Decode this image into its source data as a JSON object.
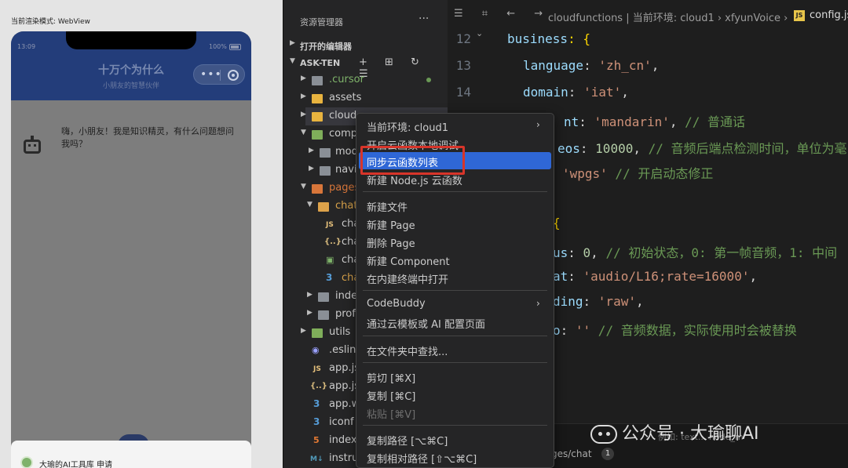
{
  "simulator": {
    "render_mode": "当前渲染模式: WebView",
    "status_time": "13:09",
    "status_battery": "100%",
    "app_title": "十万个为什么",
    "app_subtitle": "小朋友的智慧伙伴",
    "capsule_dots": "•••",
    "bot_message": "嗨，小朋友！我是知识精灵，有什么问题想问我吗？",
    "bottom_card_text": "大瑜的AI工具库 申请"
  },
  "explorer": {
    "title": "资源管理器",
    "more": "···",
    "open_editors": "打开的编辑器",
    "root": "ASK-TEN",
    "toolbar_icons": "+ ⊞ ↻ ☰",
    "items": [
      {
        "label": ".cursor"
      },
      {
        "label": "assets"
      },
      {
        "label": "cloud"
      },
      {
        "label": "comp"
      },
      {
        "label": "mod"
      },
      {
        "label": "navi"
      },
      {
        "label": "pages"
      },
      {
        "label": "chat"
      },
      {
        "label": "cha"
      },
      {
        "label": "cha"
      },
      {
        "label": "cha"
      },
      {
        "label": "cha"
      },
      {
        "label": "inde"
      },
      {
        "label": "prof"
      },
      {
        "label": "utils"
      },
      {
        "label": ".eslin"
      },
      {
        "label": "app.js"
      },
      {
        "label": "app.js"
      },
      {
        "label": "app.w"
      },
      {
        "label": "iconf"
      },
      {
        "label": "index"
      },
      {
        "label": "instru"
      }
    ],
    "file_badges": {
      "js": "JS",
      "json": "{..}",
      "css": "3",
      "html": "5",
      "md": "M↓"
    }
  },
  "editor": {
    "breadcrumb_icons": "☰ ⌗ ← →",
    "breadcrumb": "cloudfunctions | 当前环境: cloud1 › xfyunVoice ›",
    "breadcrumb_js": "JS",
    "breadcrumb_file": "config.js",
    "line_numbers": [
      "12",
      "13",
      "14"
    ],
    "lines": [
      {
        "key": "business",
        "rest": ": {"
      },
      {
        "key": "language",
        "value": "'zh_cn'",
        "tail": ","
      },
      {
        "key": "domain",
        "value": "'iat'",
        "tail": ","
      },
      {
        "key": "nt",
        "value": "'mandarin'",
        "tail": ", ",
        "comment": "// 普通话"
      },
      {
        "key": "eos",
        "num": "10000",
        "tail": ", ",
        "comment": "// 音频后端点检测时间，单位为毫"
      },
      {
        "value": "'wpgs'",
        "comment": " // 开启动态修正"
      },
      {
        "rest": "{"
      },
      {
        "key": "us",
        "num": "0",
        "tail": ", ",
        "comment": "// 初始状态，0: 第一帧音频，1: 中间"
      },
      {
        "key": "at",
        "value": "'audio/L16;rate=16000'",
        "tail": ","
      },
      {
        "key": "ding",
        "value": "'raw'",
        "tail": ","
      },
      {
        "key": "o",
        "value": "''",
        "comment": " // 音频数据，实际使用时会被替换"
      }
    ],
    "terminal_tab": "ges/chat",
    "terminal_badge": "1",
    "terminal_count": "1",
    "terminal_search": "例如: text... node_m"
  },
  "watermark": "公众号 · 大瑜聊AI",
  "context_menu": {
    "items": [
      {
        "label": "当前环境: cloud1",
        "submenu": true
      },
      {
        "label": "开启云函数本地调试"
      },
      {
        "label": "同步云函数列表",
        "active": true
      },
      {
        "label": "新建 Node.js 云函数"
      },
      {
        "label": "新建文件"
      },
      {
        "label": "新建 Page"
      },
      {
        "label": "删除 Page"
      },
      {
        "label": "新建 Component"
      },
      {
        "label": "在内建终端中打开"
      },
      {
        "label": "CodeBuddy",
        "submenu": true
      },
      {
        "label": "通过云模板或 AI 配置页面"
      },
      {
        "label": "在文件夹中查找..."
      },
      {
        "label": "剪切  [⌘X]"
      },
      {
        "label": "复制  [⌘C]"
      },
      {
        "label": "粘贴  [⌘V]",
        "disabled": true
      },
      {
        "label": "复制路径  [⌥⌘C]"
      },
      {
        "label": "复制相对路径  [⇧⌥⌘C]"
      }
    ],
    "submenu_chevron": "›"
  },
  "colors": {
    "accent": "#2f67d6",
    "highlight_box": "#d8352a",
    "nav_bar": "#233d7a"
  }
}
